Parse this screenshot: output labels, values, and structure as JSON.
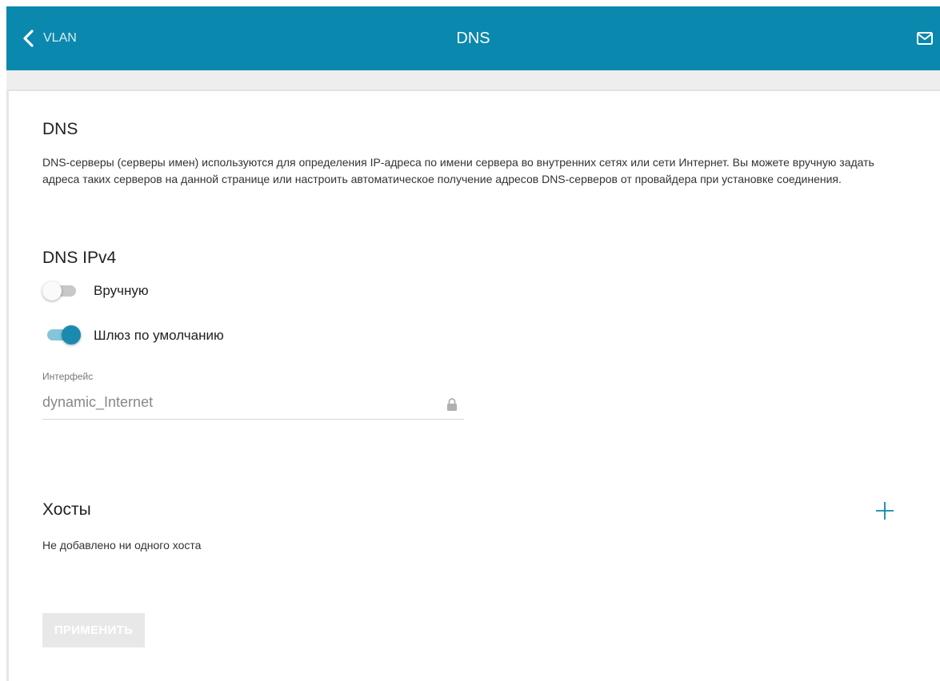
{
  "header": {
    "back_label": "VLAN",
    "title": "DNS"
  },
  "dns": {
    "heading": "DNS",
    "description": "DNS-серверы (серверы имен) используются для определения IP-адреса по имени сервера во внутренних сетях или сети Интернет. Вы можете вручную задать адреса таких серверов на данной странице или настроить автоматическое получение адресов DNS-серверов от провайдера при установке соединения."
  },
  "ipv4": {
    "heading": "DNS IPv4",
    "manual_label": "Вручную",
    "manual_on": false,
    "gateway_label": "Шлюз по умолчанию",
    "gateway_on": true,
    "interface_label": "Интерфейс",
    "interface_value": "dynamic_Internet"
  },
  "hosts": {
    "heading": "Хосты",
    "empty_text": "Не добавлено ни одного хоста"
  },
  "apply_label": "ПРИМЕНИТЬ",
  "colors": {
    "header_bg": "#0a88ad",
    "toggle_on": "#1a8ab0",
    "accent": "#0a88ad"
  },
  "icons": {
    "back": "chevron-left-icon",
    "mail": "mail-icon",
    "lock": "lock-icon",
    "add": "plus-icon"
  }
}
